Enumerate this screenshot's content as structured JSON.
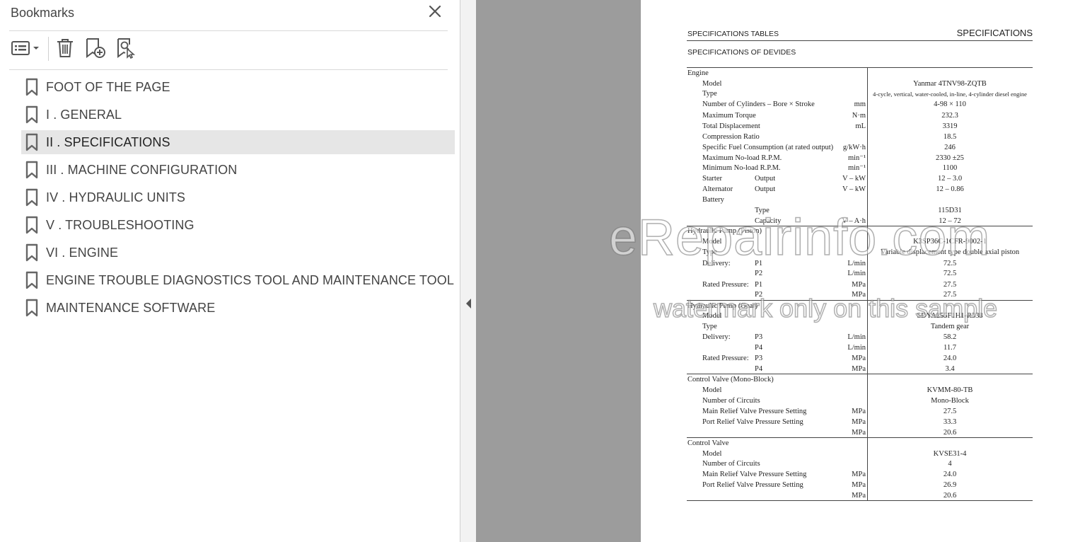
{
  "panel": {
    "title": "Bookmarks",
    "toolbar": {
      "options_icon": "options-list-icon",
      "delete_icon": "trash-icon",
      "new_bookmark_icon": "new-bookmark-icon",
      "find_bookmark_icon": "find-current-bookmark-icon"
    },
    "items": [
      {
        "label": "FOOT OF THE PAGE"
      },
      {
        "label": "I . GENERAL"
      },
      {
        "label": "II . SPECIFICATIONS"
      },
      {
        "label": "III . MACHINE CONFIGURATION"
      },
      {
        "label": "IV . HYDRAULIC UNITS"
      },
      {
        "label": "V . TROUBLESHOOTING"
      },
      {
        "label": "VI . ENGINE"
      },
      {
        "label": "ENGINE TROUBLE DIAGNOSTICS TOOL AND MAINTENANCE TOOL"
      },
      {
        "label": "MAINTENANCE SOFTWARE"
      }
    ],
    "selected_index": 2
  },
  "document": {
    "header_left": "SPECIFICATIONS TABLES",
    "header_right": "SPECIFICATIONS",
    "subtitle": "SPECIFICATIONS OF DEVIDES",
    "watermark_main": "eRepairinfo.com",
    "watermark_sub": "watermark only on this sample",
    "rows": {
      "r0": {
        "a": "Engine"
      },
      "r1": {
        "b": "Model",
        "val": "Yanmar 4TNV98-ZQTB"
      },
      "r2": {
        "b": "Type",
        "val": "4-cycle, vertical, water-cooled, in-line, 4-cylinder diesel engine"
      },
      "r3": {
        "b": "Number of Cylinders – Bore × Stroke",
        "unit": "mm",
        "val": "4-98 × 110"
      },
      "r4": {
        "b": "Maximum Torque",
        "unit": "N·m",
        "val": "232.3"
      },
      "r5": {
        "b": "Total Displacement",
        "unit": "mL",
        "val": "3319"
      },
      "r6": {
        "b": "Compression Ratio",
        "val": "18.5"
      },
      "r7": {
        "b": "Specific Fuel Consumption (at rated output)",
        "unit": "g/kW·h",
        "val": "246"
      },
      "r8": {
        "b": "Maximum No-load R.P.M.",
        "unit": "min⁻¹",
        "val": "2330 ±25"
      },
      "r9": {
        "b": "Minimum No-load R.P.M.",
        "unit": "min⁻¹",
        "val": "1100"
      },
      "r10": {
        "b": "Starter",
        "c": "Output",
        "unit": "V – kW",
        "val": "12 – 3.0"
      },
      "r11": {
        "b": "Alternator",
        "c": "Output",
        "unit": "V – kW",
        "val": "12 – 0.86"
      },
      "r12": {
        "b": "Battery"
      },
      "r13": {
        "c": "Type",
        "val": "115D31"
      },
      "r14": {
        "c": "Capacity",
        "unit": "V – A·h",
        "val": "12 – 72"
      },
      "r15": {
        "a": "Hydraulic Pump (Piston)"
      },
      "r16": {
        "b": "Model",
        "val": "K3SP36C-1CFR-9002-1"
      },
      "r17": {
        "b": "Type",
        "val": "Variable displacement type double axial piston"
      },
      "r18": {
        "b": "Delivery:",
        "c": "P1",
        "unit": "L/min",
        "val": "72.5"
      },
      "r19": {
        "c": "P2",
        "unit": "L/min",
        "val": "72.5"
      },
      "r20": {
        "b": "Rated Pressure:",
        "c": "P1",
        "unit": "MPa",
        "val": "27.5"
      },
      "r21": {
        "c": "P2",
        "unit": "MPa",
        "val": "27.5"
      },
      "r22": {
        "a": "Hydraulic Pump (Gear)"
      },
      "r23": {
        "b": "Model",
        "val": "SDYA255F1H1-R338"
      },
      "r24": {
        "b": "Type",
        "val": "Tandem gear"
      },
      "r25": {
        "b": "Delivery:",
        "c": "P3",
        "unit": "L/min",
        "val": "58.2"
      },
      "r26": {
        "c": "P4",
        "unit": "L/min",
        "val": "11.7"
      },
      "r27": {
        "b": "Rated Pressure:",
        "c": "P3",
        "unit": "MPa",
        "val": "24.0"
      },
      "r28": {
        "c": "P4",
        "unit": "MPa",
        "val": "3.4"
      },
      "r29": {
        "a": "Control Valve (Mono-Block)"
      },
      "r30": {
        "b": "Model",
        "val": "KVMM-80-TB"
      },
      "r31": {
        "b": "Number of Circuits",
        "val": "Mono-Block"
      },
      "r32": {
        "b": "Main Relief Valve Pressure Setting",
        "unit": "MPa",
        "val": "27.5"
      },
      "r33": {
        "b": "Port Relief Valve Pressure Setting",
        "unit": "MPa",
        "val": "33.3"
      },
      "r34": {
        "unit": "MPa",
        "val": "20.6"
      },
      "r35": {
        "a": "Control Valve"
      },
      "r36": {
        "b": "Model",
        "val": "KVSE31-4"
      },
      "r37": {
        "b": "Number of Circuits",
        "val": "4"
      },
      "r38": {
        "b": "Main Relief Valve Pressure Setting",
        "unit": "MPa",
        "val": "24.0"
      },
      "r39": {
        "b": "Port Relief Valve Pressure Setting",
        "unit": "MPa",
        "val": "26.9"
      },
      "r40": {
        "unit": "MPa",
        "val": "20.6"
      }
    }
  }
}
